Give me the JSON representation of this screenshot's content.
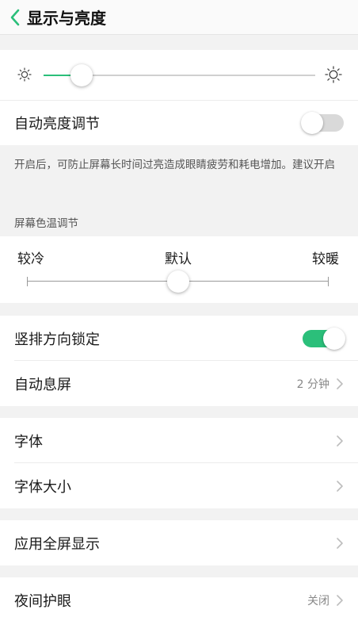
{
  "header": {
    "title": "显示与亮度",
    "back_icon": "chevron-left-icon"
  },
  "colors": {
    "accent": "#2bbf7a",
    "background": "#f2f2f2"
  },
  "brightness": {
    "level_fraction": 0.14,
    "min_icon": "sun-small-icon",
    "max_icon": "sun-large-icon",
    "auto_label": "自动亮度调节",
    "auto_enabled": false,
    "note": "开启后，可防止屏幕长时间过亮造成眼睛疲劳和耗电增加。建议开启"
  },
  "color_temp": {
    "section_label": "屏幕色温调节",
    "cool_label": "较冷",
    "default_label": "默认",
    "warm_label": "较暖",
    "level_fraction": 0.5
  },
  "orientation": {
    "label": "竖排方向锁定",
    "enabled": true
  },
  "auto_sleep": {
    "label": "自动息屏",
    "value": "2 分钟"
  },
  "font": {
    "label": "字体"
  },
  "font_size": {
    "label": "字体大小"
  },
  "fullscreen": {
    "label": "应用全屏显示"
  },
  "night_mode": {
    "label": "夜间护眼",
    "value": "关闭"
  }
}
